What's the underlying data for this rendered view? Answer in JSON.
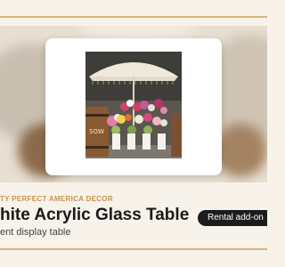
{
  "product": {
    "brand": "TY PERFECT AMERICA DECOR",
    "title": "hite Acrylic Glass Table",
    "subtitle": "ent display table",
    "badge": "Rental add-on"
  },
  "photo": {
    "sign_text": "SOW"
  },
  "colors": {
    "accent": "#c9944a",
    "rule": "#d9b57a",
    "badge_bg": "#1c1c1c",
    "background": "#f7f2ea"
  }
}
